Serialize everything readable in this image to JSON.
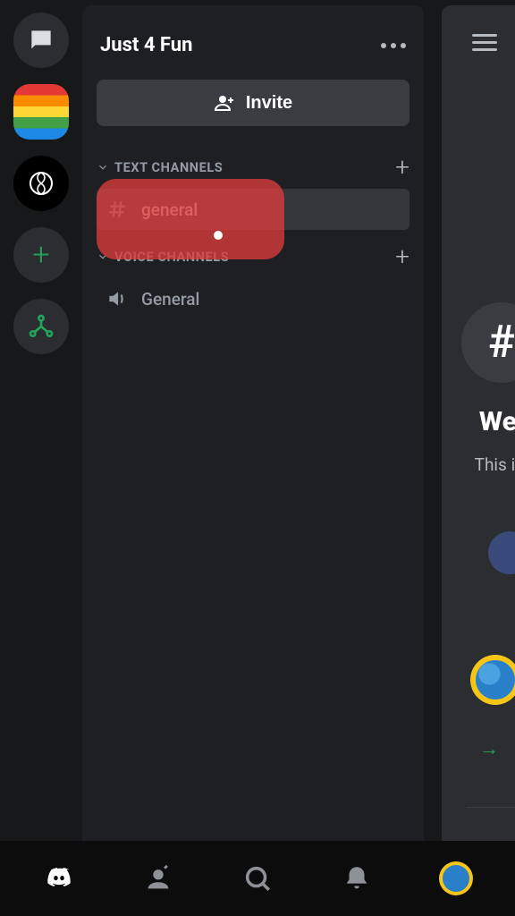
{
  "server": {
    "title": "Just 4 Fun",
    "invite_label": "Invite"
  },
  "categories": {
    "text": {
      "label": "TEXT CHANNELS"
    },
    "voice": {
      "label": "VOICE CHANNELS"
    }
  },
  "channels": {
    "text_general": "general",
    "voice_general": "General"
  },
  "chat": {
    "welcome_prefix": "Wel",
    "subline_prefix": "This is"
  },
  "icons": {
    "dm": "chat-bubble-icon",
    "rainbow_server": "rainbow-server-icon",
    "openai_server": "openai-server-icon",
    "add_server": "plus-icon",
    "server_discovery": "hub-icon",
    "more": "more-icon",
    "invite_person": "person-plus-icon",
    "chevron_down": "chevron-down-icon",
    "add_channel": "plus-icon",
    "hash": "hash-icon",
    "speaker": "speaker-icon",
    "burger": "menu-icon",
    "arrow": "arrow-right-icon"
  },
  "nav": {
    "home": "discord-logo-icon",
    "friends": "friend-wave-icon",
    "search": "search-icon",
    "notifications": "bell-icon",
    "profile": "avatar"
  }
}
